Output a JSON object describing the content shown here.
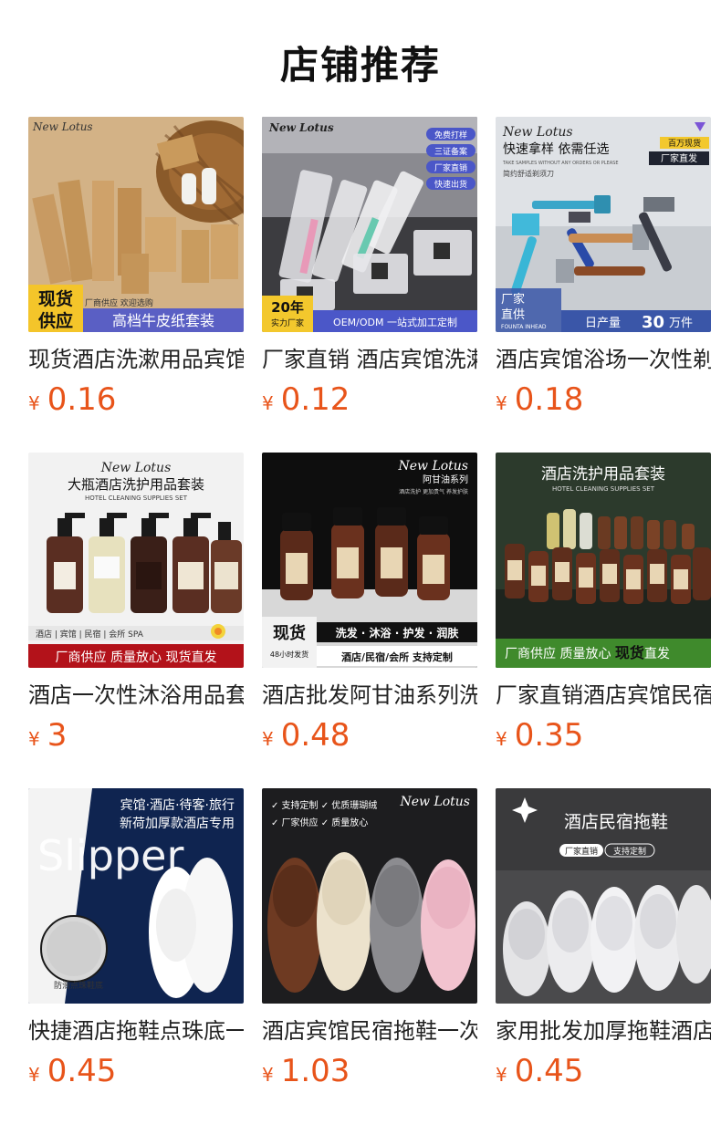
{
  "section_title": "店铺推荐",
  "currency": "¥",
  "products": [
    {
      "name": "现货酒店洗漱用品宾馆",
      "price": "0.16",
      "img": {
        "brand": "New Lotus",
        "badge_l1": "现货",
        "badge_l2": "供应",
        "small": "厂商供应 欢迎选购",
        "banner": "高档牛皮纸套装"
      }
    },
    {
      "name": "厂家直销 酒店宾馆洗漱",
      "price": "0.12",
      "img": {
        "brand": "New Lotus",
        "tags": [
          "免费打样",
          "三证备案",
          "厂家直销",
          "快速出货"
        ],
        "years": "20年",
        "years_sub": "实力厂家",
        "banner": "OEM/ODM 一站式加工定制"
      }
    },
    {
      "name": "酒店宾馆浴场一次性剃",
      "price": "0.18",
      "img": {
        "brand": "New Lotus",
        "headline": "快速拿样 依需任选",
        "sub_en": "TAKE SAMPLES WITHOUT ANY ORDERS OR PLEASE",
        "sub_cn": "简约舒适剃须刀",
        "tag1": "百万现货",
        "tag2": "厂家直发",
        "corner1": "厂家",
        "corner2": "直供",
        "corner_en": "FOUNTA INHEAD",
        "output_pre": "日产量",
        "output_num": "30",
        "output_post": "万件"
      }
    },
    {
      "name": "酒店一次性沐浴用品套",
      "price": "3",
      "img": {
        "brand": "New Lotus",
        "headline": "大瓶酒店洗护用品套装",
        "sub_en": "HOTEL CLEANING SUPPLIES SET",
        "strip": "酒店 | 宾馆 | 民宿 | 会所 SPA",
        "banner": "厂商供应   质量放心   现货直发"
      }
    },
    {
      "name": "酒店批发阿甘油系列洗",
      "price": "0.48",
      "img": {
        "brand": "New Lotus",
        "series": "阿甘油系列",
        "series_sub": "酒店洗护 更加贵气 养发护肤",
        "badge": "现货",
        "badge_sub": "48小时发货",
        "line1": "洗发 · 沐浴 · 护发 · 润肤",
        "line2": "酒店/民宿/会所  支持定制"
      }
    },
    {
      "name": "厂家直销酒店宾馆民宿",
      "price": "0.35",
      "img": {
        "headline": "酒店洗护用品套装",
        "sub_en": "HOTEL CLEANING SUPPLIES SET",
        "banner_a": "厂商供应  质量放心  ",
        "banner_b": "现货",
        "banner_c": "直发"
      }
    },
    {
      "name": "快捷酒店拖鞋点珠底一",
      "price": "0.45",
      "img": {
        "line1": "宾馆·酒店·待客·旅行",
        "line2": "新荷加厚款酒店专用",
        "word": "Slipper",
        "caption": "防滑点珠鞋底"
      }
    },
    {
      "name": "酒店宾馆民宿拖鞋一次",
      "price": "1.03",
      "img": {
        "brand": "New Lotus",
        "check1": "✓ 支持定制  ✓ 优质珊瑚绒",
        "check2": "✓ 厂家供应  ✓ 质量放心"
      }
    },
    {
      "name": "家用批发加厚拖鞋酒店",
      "price": "0.45",
      "img": {
        "headline": "酒店民宿拖鞋",
        "pill1": "厂家直销",
        "pill2": "支持定制"
      }
    }
  ]
}
